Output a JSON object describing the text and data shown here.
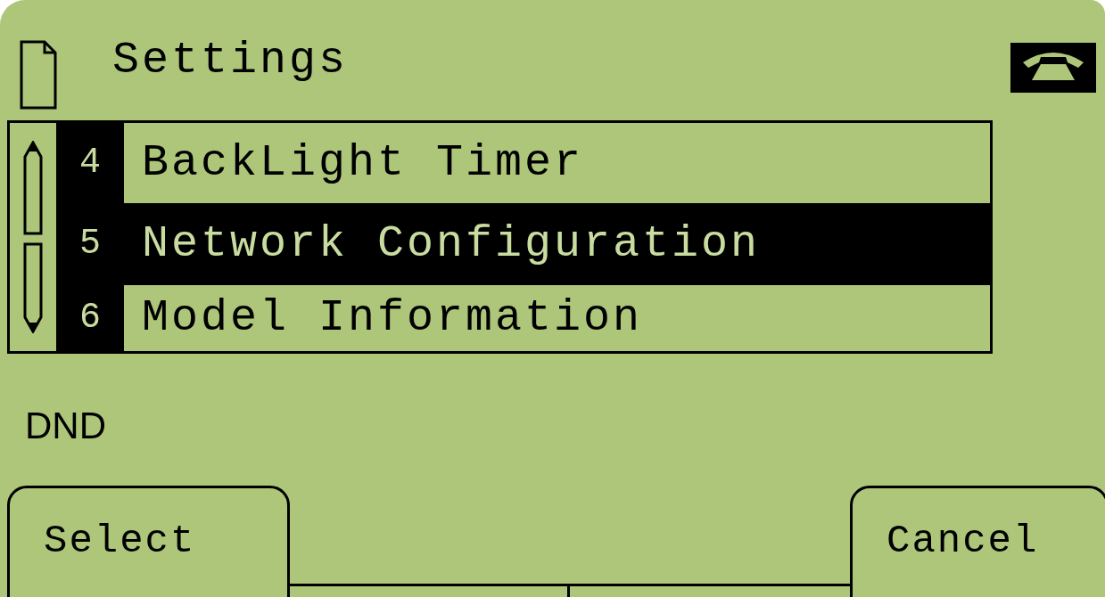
{
  "header": {
    "title": "Settings"
  },
  "menu": {
    "items": [
      {
        "number": "4",
        "label": "BackLight Timer",
        "selected": false
      },
      {
        "number": "5",
        "label": "Network Configuration",
        "selected": true
      },
      {
        "number": "6",
        "label": "Model Information",
        "selected": false
      }
    ]
  },
  "status_text": "DND",
  "softkeys": {
    "left": {
      "label": "Select"
    },
    "right": {
      "label": "Cancel"
    }
  }
}
